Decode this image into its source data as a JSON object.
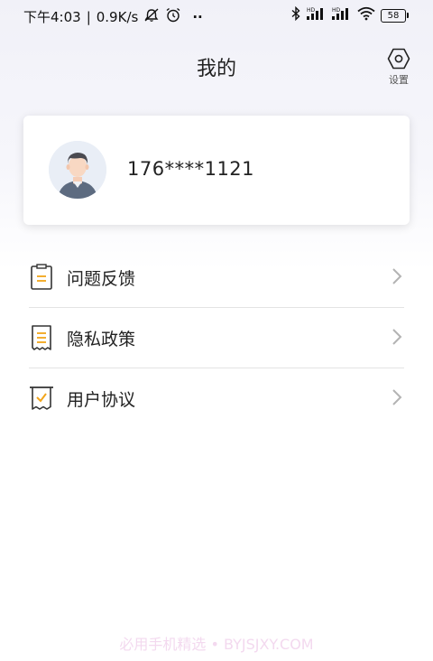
{
  "status_bar": {
    "time": "下午4:03",
    "separator": "|",
    "speed": "0.9K/s",
    "dots": "··",
    "battery": "58"
  },
  "header": {
    "title": "我的",
    "settings_label": "设置"
  },
  "profile": {
    "phone": "176****1121"
  },
  "menu": {
    "items": [
      {
        "label": "问题反馈",
        "icon": "feedback-icon"
      },
      {
        "label": "隐私政策",
        "icon": "privacy-policy-icon"
      },
      {
        "label": "用户协议",
        "icon": "user-agreement-icon"
      }
    ]
  },
  "watermark": "必用手机精选 • BYJSJXY.COM",
  "colors": {
    "accent": "#f2a51a",
    "icon_outline": "#333333",
    "arrow": "#b3b3b3",
    "background_tint": "#f1f1f8"
  }
}
